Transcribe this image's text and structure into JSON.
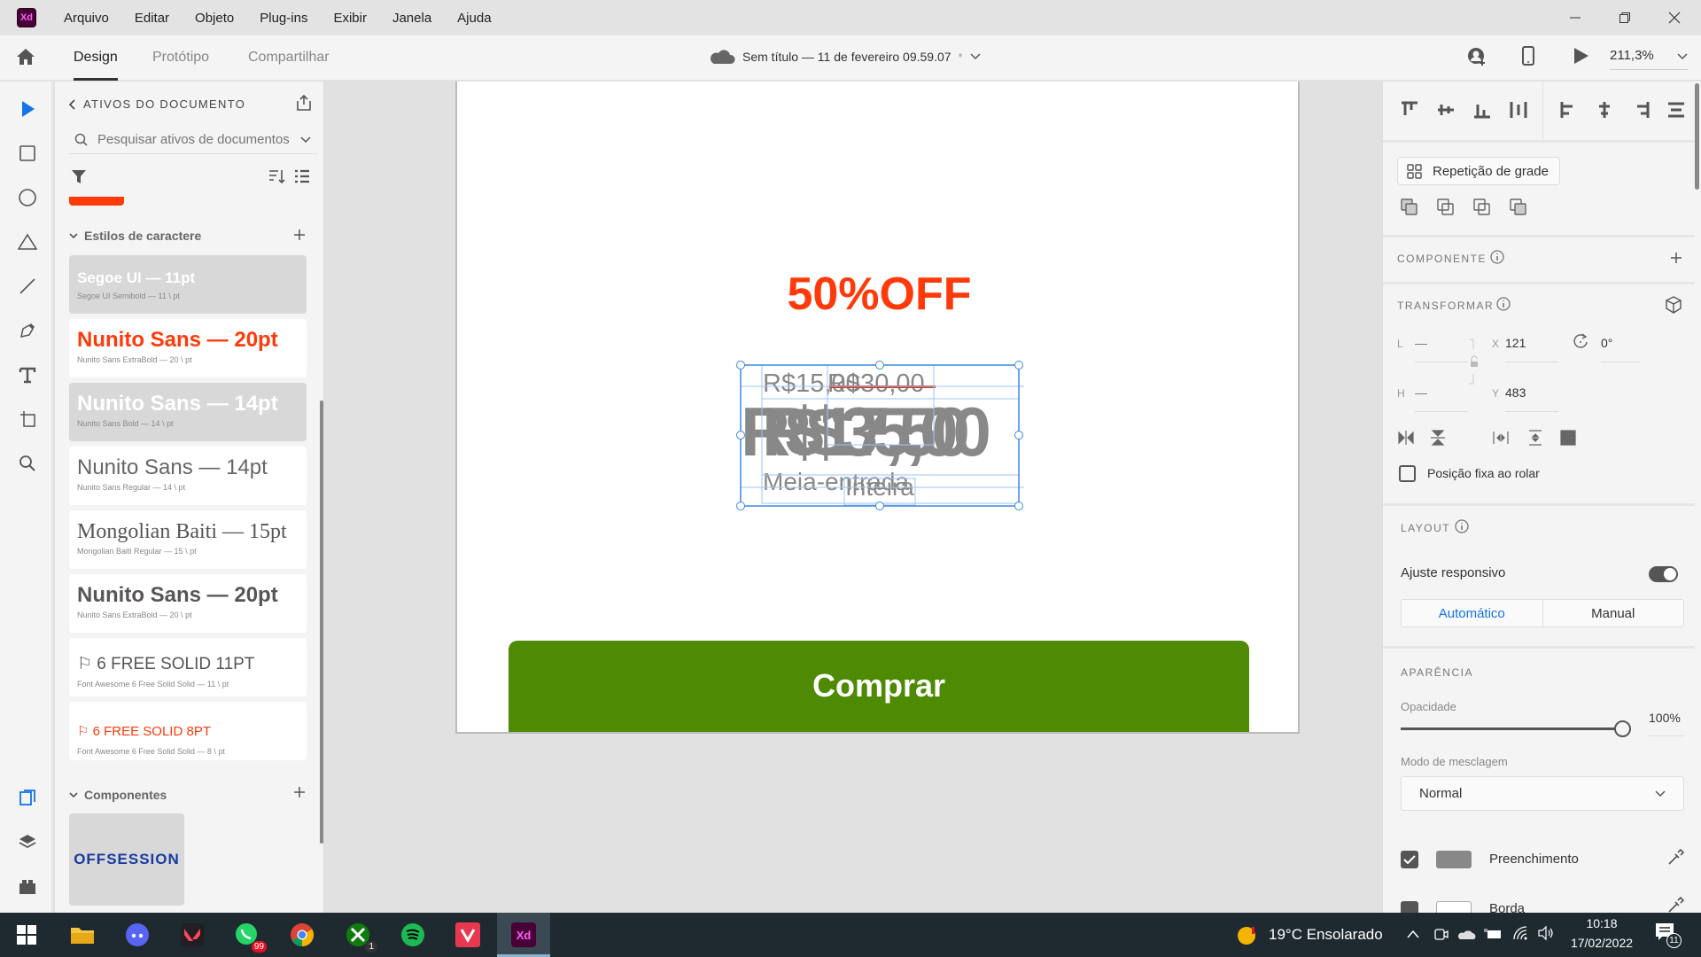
{
  "app": {
    "logo": "Xd",
    "brand_color": "#470137",
    "brand_text_color": "#ff61f6"
  },
  "menu": [
    "Arquivo",
    "Editar",
    "Objeto",
    "Plug-ins",
    "Exibir",
    "Janela",
    "Ajuda"
  ],
  "window_controls": {
    "minimize": "minimize-icon",
    "restore": "restore-icon",
    "close": "close-icon"
  },
  "toolbar": {
    "tabs": [
      {
        "label": "Design",
        "active": true
      },
      {
        "label": "Protótipo",
        "active": false
      },
      {
        "label": "Compartilhar",
        "active": false
      }
    ],
    "doc_title": "Sem título — 11 de fevereiro 09.59.07",
    "unsaved_marker": "*",
    "zoom": "211,3%"
  },
  "tools": [
    "select-tool",
    "rectangle-tool",
    "ellipse-tool",
    "polygon-tool",
    "line-tool",
    "pen-tool",
    "text-tool",
    "artboard-tool",
    "zoom-tool",
    "assets-tool",
    "layers-tool",
    "plugins-tool"
  ],
  "assets": {
    "header": "ATIVOS DO DOCUMENTO",
    "search_placeholder": "Pesquisar ativos de documentos",
    "accent_color": "#ff3a0a",
    "char_styles_title": "Estilos de caractere",
    "char_styles": [
      {
        "name": "Segoe UI — 11pt",
        "detail": "Segoe UI Semibold — 11 \\ pt",
        "color": "#ffffff",
        "selected": true
      },
      {
        "name": "Nunito Sans — 20pt",
        "detail": "Nunito Sans ExtraBold — 20 \\ pt",
        "color": "#ff3a0a",
        "selected": false
      },
      {
        "name": "Nunito Sans — 14pt",
        "detail": "Nunito Sans Bold — 14 \\ pt",
        "color": "#ffffff",
        "selected": true
      },
      {
        "name": "Nunito Sans — 14pt",
        "detail": "Nunito Sans Regular — 14 \\ pt",
        "color": "#666666",
        "selected": false
      },
      {
        "name": "Mongolian Baiti — 15pt",
        "detail": "Mongolian Baiti Regular — 15 \\ pt",
        "color": "#555555",
        "selected": false
      },
      {
        "name": "Nunito Sans — 20pt",
        "detail": "Nunito Sans ExtraBold — 20 \\ pt",
        "color": "#5a5555",
        "selected": false
      },
      {
        "name": "⚐ 6 FREE SOLID  11PT",
        "detail": "Font Awesome 6 Free Solid Solid — 11 \\ pt",
        "color": "#555555",
        "selected": false
      },
      {
        "name": "⚐ 6 FREE SOLID  8PT",
        "detail": "Font Awesome 6 Free Solid Solid — 8 \\ pt",
        "color": "#ff3a0a",
        "selected": false
      }
    ],
    "components_title": "Componentes",
    "component_thumb": {
      "off": "OFF",
      "session": "SESSION"
    }
  },
  "artboard": {
    "headline": "50%OFF",
    "headline_color": "#ff3a0a",
    "price_old_half": "R$15,00",
    "price_old_full": "R$30,00",
    "price_big_a": "R$17,50",
    "price_big_b": "R$35,00",
    "label_half": "Meia-entrada",
    "label_full": "Inteira",
    "buy_button": "Comprar",
    "buy_color": "#4e8a03"
  },
  "props": {
    "repeat_grid": "Repetição de grade",
    "component_title": "COMPONENTE",
    "transform_title": "TRANSFORMAR",
    "w_label": "L",
    "w_value": "—",
    "h_label": "H",
    "h_value": "—",
    "x_label": "X",
    "x_value": "121",
    "y_label": "Y",
    "y_value": "483",
    "rotation": "0°",
    "fixed_position": "Posição fixa ao rolar",
    "layout_title": "LAYOUT",
    "responsive": "Ajuste responsivo",
    "responsive_on": true,
    "auto": "Automático",
    "manual": "Manual",
    "appearance_title": "APARÊNCIA",
    "opacity_label": "Opacidade",
    "opacity_value": "100%",
    "opacity_fraction": 1.0,
    "blend_label": "Modo de mesclagem",
    "blend_value": "Normal",
    "fill_label": "Preenchimento",
    "fill_color": "#888888",
    "border_label": "Borda"
  },
  "taskbar": {
    "weather": "19°C  Ensolarado",
    "time": "10:18",
    "date": "17/02/2022",
    "notifications": "11",
    "whatsapp_badge": "99",
    "xbox_badge": "1"
  }
}
